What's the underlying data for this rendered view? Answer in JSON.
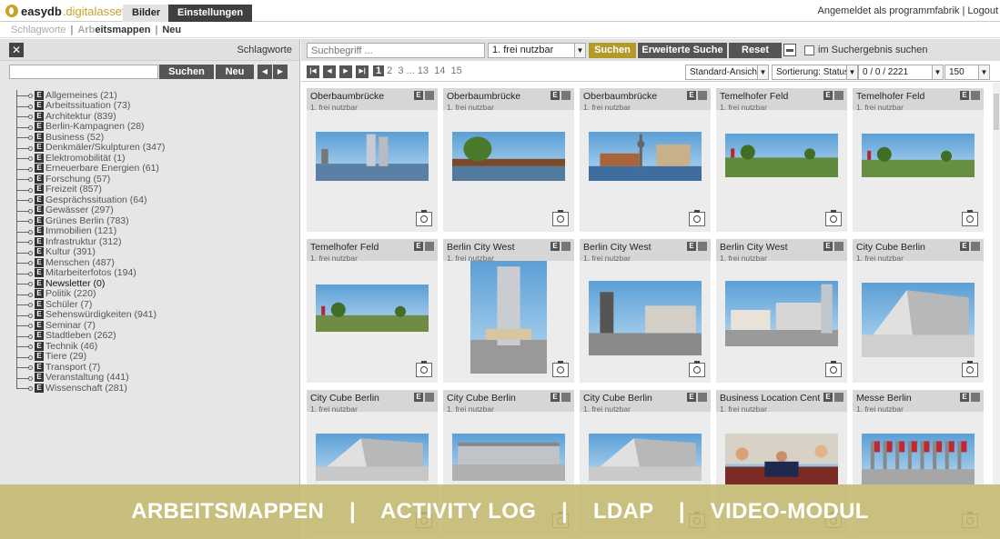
{
  "brand": {
    "name_bold": "easydb",
    "name_accent": ".digitalasset"
  },
  "main_tabs": [
    {
      "label": "Bilder"
    },
    {
      "label": "Einstellungen"
    }
  ],
  "login_info": "Angemeldet als programmfabrik | Logout",
  "subnav": {
    "item1": "Schlagworte",
    "sep": "|",
    "item2_fade": "Arb",
    "item2_rest": "eitsmappen",
    "item3": "Neu"
  },
  "left": {
    "title": "Schlagworte",
    "close_icon": "close-icon",
    "search_button": "Suchen",
    "new_button": "Neu",
    "tree": [
      {
        "label": "Allgemeines (21)"
      },
      {
        "label": "Arbeitssituation (73)"
      },
      {
        "label": "Architektur (839)"
      },
      {
        "label": "Berlin-Kampagnen (28)"
      },
      {
        "label": "Business (52)"
      },
      {
        "label": "Denkmäler/Skulpturen (347)"
      },
      {
        "label": "Elektromobilität (1)"
      },
      {
        "label": "Erneuerbare Energien (61)"
      },
      {
        "label": "Forschung (57)"
      },
      {
        "label": "Freizeit (857)"
      },
      {
        "label": "Gesprächssituation (64)"
      },
      {
        "label": "Gewässer (297)"
      },
      {
        "label": "Grünes Berlin (783)"
      },
      {
        "label": "Immobilien (121)"
      },
      {
        "label": "Infrastruktur (312)"
      },
      {
        "label": "Kultur (391)"
      },
      {
        "label": "Menschen (487)"
      },
      {
        "label": "Mitarbeiterfotos (194)"
      },
      {
        "label": "Newsletter (0)",
        "bold": true
      },
      {
        "label": "Politik (220)"
      },
      {
        "label": "Schüler (7)"
      },
      {
        "label": "Sehenswürdigkeiten (941)"
      },
      {
        "label": "Seminar (7)"
      },
      {
        "label": "Stadtleben (262)"
      },
      {
        "label": "Technik (46)"
      },
      {
        "label": "Tiere (29)"
      },
      {
        "label": "Transport (7)"
      },
      {
        "label": "Veranstaltung (441)"
      },
      {
        "label": "Wissenschaft (281)"
      }
    ]
  },
  "search": {
    "placeholder": "Suchbegriff ...",
    "filter_value": "1. frei nutzbar",
    "search_button": "Suchen",
    "advanced_button": "Erweiterte Suche",
    "reset_button": "Reset",
    "in_results_label": "im Suchergebnis suchen"
  },
  "pager": {
    "current": "1",
    "pages": "2  3 ... 13  14  15",
    "view": "Standard-Ansicht",
    "sort": "Sortierung: Status",
    "count": "0 / 0 / 2221",
    "per_page": "150"
  },
  "cards": [
    {
      "title": "Oberbaumbrücke",
      "sub": "1. frei nutzbar",
      "e": "E"
    },
    {
      "title": "Oberbaumbrücke",
      "sub": "1. frei nutzbar",
      "e": "E"
    },
    {
      "title": "Oberbaumbrücke",
      "sub": "1. frei nutzbar",
      "e": "E"
    },
    {
      "title": "Temelhofer Feld",
      "sub": "1. frei nutzbar",
      "e": "E"
    },
    {
      "title": "Temelhofer Feld",
      "sub": "1. frei nutzbar",
      "e": "E"
    },
    {
      "title": "Temelhofer Feld",
      "sub": "1. frei nutzbar",
      "e": "E"
    },
    {
      "title": "Berlin City West",
      "sub": "1. frei nutzbar",
      "e": "E"
    },
    {
      "title": "Berlin City West",
      "sub": "1. frei nutzbar",
      "e": "E"
    },
    {
      "title": "Berlin City West",
      "sub": "1. frei nutzbar",
      "e": "E"
    },
    {
      "title": "City Cube Berlin",
      "sub": "1. frei nutzbar",
      "e": "E"
    },
    {
      "title": "City Cube Berlin",
      "sub": "1. frei nutzbar",
      "e": "E"
    },
    {
      "title": "City Cube Berlin",
      "sub": "1. frei nutzbar",
      "e": "E"
    },
    {
      "title": "City Cube Berlin",
      "sub": "1. frei nutzbar",
      "e": "E"
    },
    {
      "title": "Business Location Cente",
      "sub": "1. frei nutzbar",
      "e": "E"
    },
    {
      "title": "Messe Berlin",
      "sub": "1. frei nutzbar",
      "e": "E"
    }
  ],
  "overlay_text": "ARBEITSMAPPEN    |    ACTIVITY LOG    |    LDAP    |    VIDEO-MODUL"
}
